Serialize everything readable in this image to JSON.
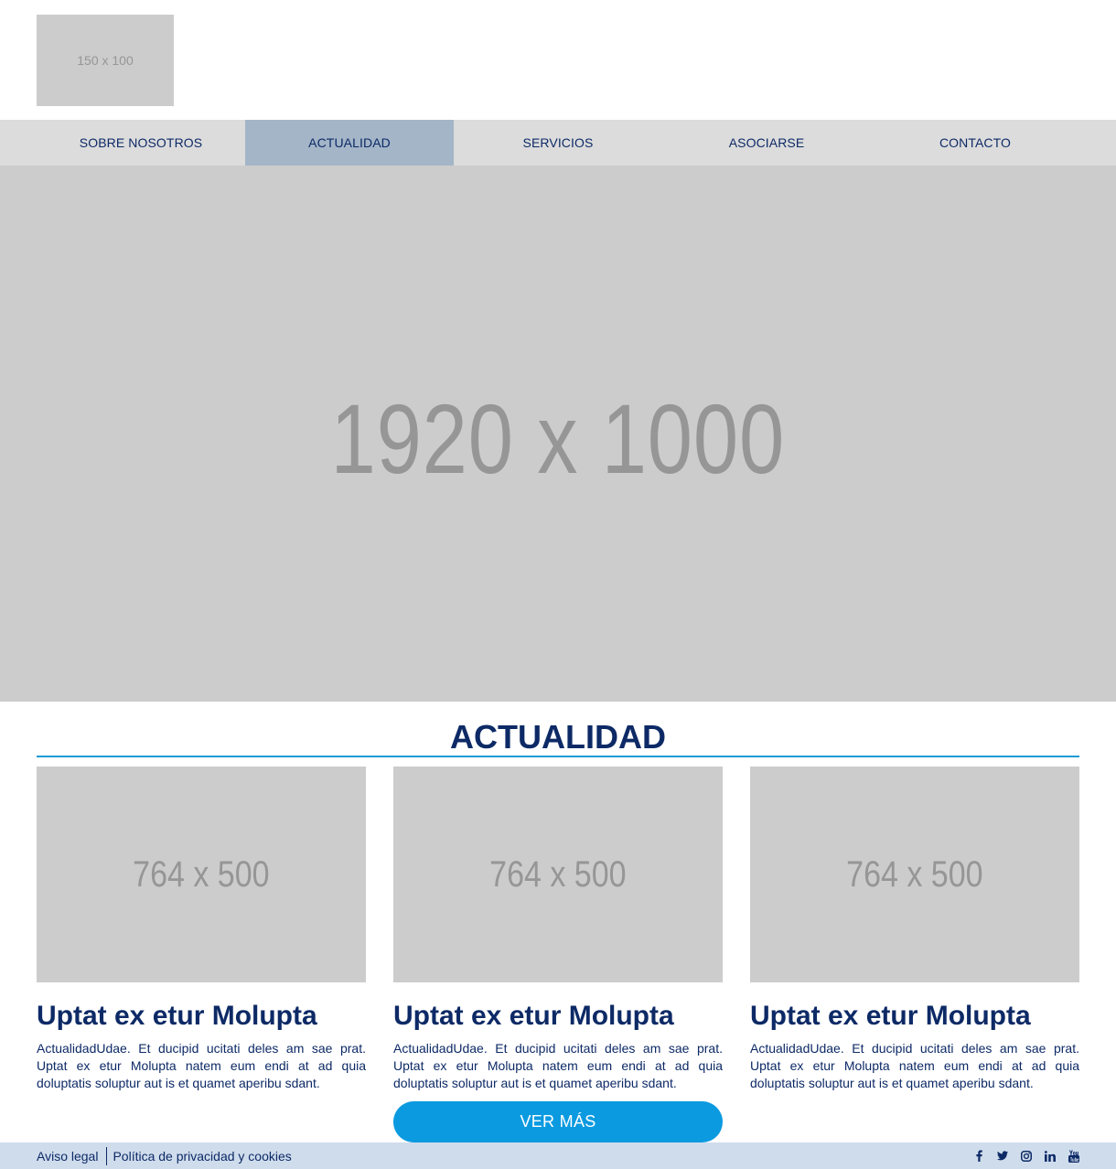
{
  "header": {
    "logo_placeholder": "150 x 100"
  },
  "nav": {
    "items": [
      {
        "label": "SOBRE NOSOTROS"
      },
      {
        "label": "ACTUALIDAD",
        "active": true
      },
      {
        "label": "SERVICIOS"
      },
      {
        "label": "ASOCIARSE"
      },
      {
        "label": "CONTACTO"
      }
    ]
  },
  "hero": {
    "placeholder": "1920 x 1000"
  },
  "news": {
    "title": "ACTUALIDAD",
    "cards": [
      {
        "image_placeholder": "764 x 500",
        "title": "Uptat ex etur Molupta",
        "text": "ActualidadUdae. Et ducipid ucitati deles am sae prat. Uptat ex etur Molupta natem eum endi at ad quia doluptatis soluptur aut is et quamet aperibu sdant."
      },
      {
        "image_placeholder": "764 x 500",
        "title": "Uptat ex etur Molupta",
        "text": "ActualidadUdae. Et ducipid ucitati deles am sae prat. Uptat ex etur Molupta natem eum endi at ad quia doluptatis soluptur aut is et quamet aperibu sdant."
      },
      {
        "image_placeholder": "764 x 500",
        "title": "Uptat ex etur Molupta",
        "text": "ActualidadUdae. Et ducipid ucitati deles am sae prat. Uptat ex etur Molupta natem eum endi at ad quia doluptatis soluptur aut is et quamet aperibu sdant."
      }
    ],
    "more_label": "VER MÁS"
  },
  "footer": {
    "legal_label": "Aviso legal",
    "privacy_label": "Política de privacidad y cookies",
    "social": [
      "facebook-icon",
      "twitter-icon",
      "instagram-icon",
      "linkedin-icon",
      "youtube-icon"
    ]
  },
  "colors": {
    "brand_dark": "#0d2a66",
    "accent": "#0b9ae0",
    "nav_bg": "#dcdcdc",
    "nav_active": "#a3b5c7",
    "footer_bg": "#cfdcec",
    "placeholder_bg": "#cccccc"
  }
}
